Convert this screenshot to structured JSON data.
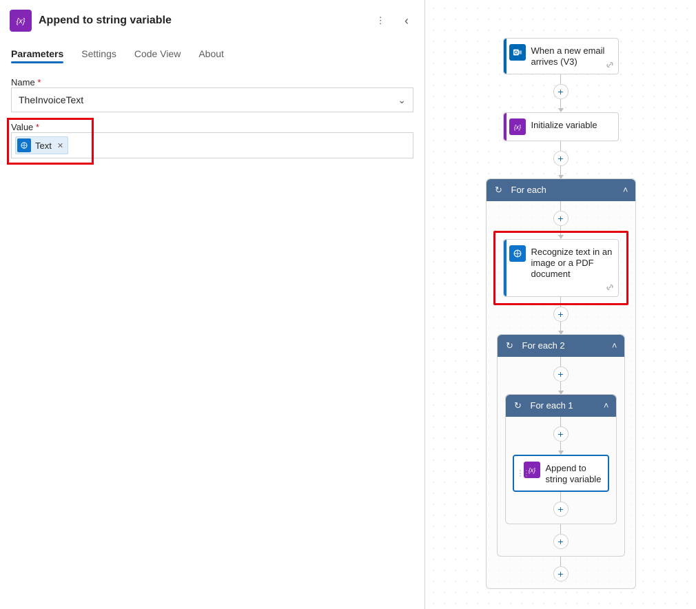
{
  "panel": {
    "title": "Append to string variable",
    "tabs": [
      {
        "id": "parameters",
        "label": "Parameters",
        "active": true
      },
      {
        "id": "settings",
        "label": "Settings",
        "active": false
      },
      {
        "id": "codeview",
        "label": "Code View",
        "active": false
      },
      {
        "id": "about",
        "label": "About",
        "active": false
      }
    ],
    "fields": {
      "name": {
        "label": "Name",
        "value": "TheInvoiceText",
        "required": true
      },
      "value": {
        "label": "Value",
        "required": true,
        "token": {
          "label": "Text",
          "icon": "cv-icon"
        }
      }
    },
    "icons": {
      "more": "⋮",
      "collapse": "‹",
      "chevron_down": "⌄"
    }
  },
  "flow": {
    "nodes": {
      "email": {
        "title": "When a new email arrives (V3)",
        "icon": "outlook-icon"
      },
      "init": {
        "title": "Initialize variable",
        "icon": "variable-icon"
      },
      "foreach": {
        "title": "For each"
      },
      "recognize": {
        "title": "Recognize text in an image or a PDF document",
        "icon": "cv-icon"
      },
      "foreach2": {
        "title": "For each 2"
      },
      "foreach1": {
        "title": "For each 1"
      },
      "append": {
        "title": "Append to string variable",
        "icon": "variable-icon",
        "selected": true
      }
    },
    "glyphs": {
      "add": "+",
      "loop": "⭯",
      "chevron_up": "˄",
      "link": "🔗",
      "handle": "⋮⋮"
    }
  }
}
